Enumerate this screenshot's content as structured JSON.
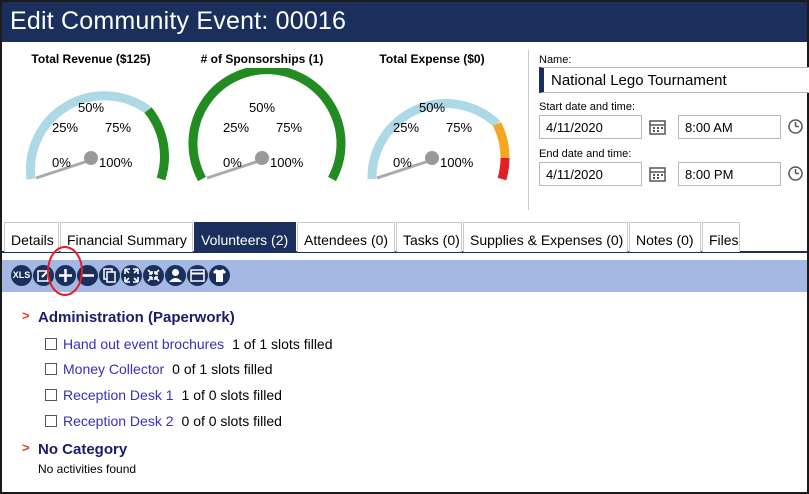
{
  "header": {
    "title": "Edit Community Event: 00016"
  },
  "gauges": [
    {
      "title": "Total Revenue ($125)",
      "labels": [
        "0%",
        "25%",
        "50%",
        "75%",
        "100%"
      ],
      "needle_percent": 0.1,
      "bands": [
        {
          "color": "#add8e6"
        },
        {
          "color": "#228b22"
        }
      ]
    },
    {
      "title": "# of Sponsorships (1)",
      "labels": [
        "0%",
        "25%",
        "50%",
        "75%",
        "100%"
      ],
      "needle_percent": 0.1,
      "bands": [
        {
          "color": "#228b22"
        }
      ]
    },
    {
      "title": "Total Expense ($0)",
      "labels": [
        "0%",
        "25%",
        "50%",
        "75%",
        "100%"
      ],
      "needle_percent": 0.1,
      "bands": [
        {
          "color": "#add8e6"
        },
        {
          "color": "#f5a623"
        },
        {
          "color": "#e31e24"
        }
      ]
    }
  ],
  "form": {
    "name_label": "Name:",
    "name_value": "National Lego Tournament",
    "start_label": "Start date and time:",
    "start_date": "4/11/2020",
    "start_time": "8:00 AM",
    "end_label": "End date and time:",
    "end_date": "4/11/2020",
    "end_time": "8:00 PM"
  },
  "tabs": [
    "Details",
    "Financial Summary",
    "Volunteers (2)",
    "Attendees (0)",
    "Tasks (0)",
    "Supplies & Expenses (0)",
    "Notes (0)",
    "Files"
  ],
  "active_tab": "Volunteers (2)",
  "toolbar": {
    "buttons": [
      {
        "icon": "xls-icon",
        "text": "XLS"
      },
      {
        "icon": "edit-icon"
      },
      {
        "icon": "plus-icon"
      },
      {
        "icon": "minus-icon"
      },
      {
        "icon": "copy-icon"
      },
      {
        "icon": "expand-icon"
      },
      {
        "icon": "collapse-icon"
      },
      {
        "icon": "person-icon"
      },
      {
        "icon": "calendar-icon"
      },
      {
        "icon": "shirt-icon"
      }
    ]
  },
  "sections": [
    {
      "title": "Administration (Paperwork)",
      "items": [
        {
          "label": "Hand out event brochures",
          "status": "1 of 1 slots filled"
        },
        {
          "label": "Money Collector",
          "status": "0 of 1 slots filled"
        },
        {
          "label": "Reception Desk 1",
          "status": "1 of 0 slots filled"
        },
        {
          "label": "Reception Desk 2",
          "status": "0 of 0 slots filled"
        }
      ]
    },
    {
      "title": "No Category",
      "empty_text": "No activities found"
    }
  ]
}
